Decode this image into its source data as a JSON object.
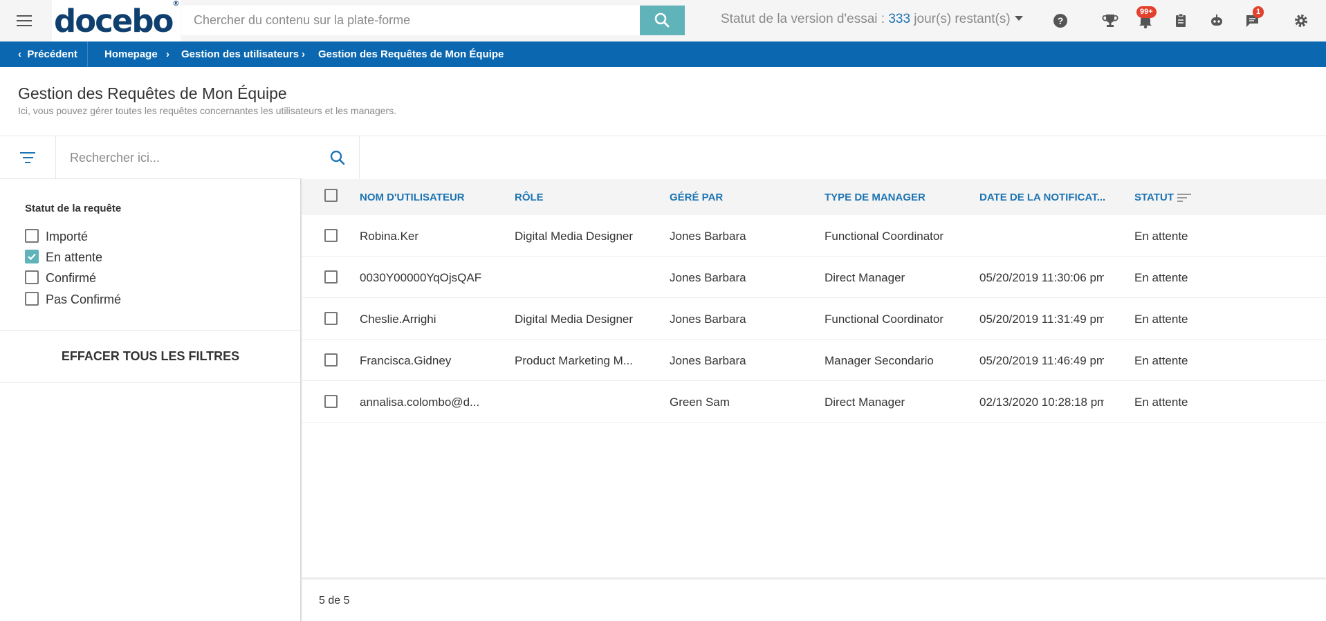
{
  "topbar": {
    "logo": "docebo",
    "logo_mark": "®",
    "search_placeholder": "Chercher du contenu sur la plate-forme",
    "trial_prefix": "Statut de la version d'essai : ",
    "trial_days": "333",
    "trial_suffix": " jour(s) restant(s)",
    "notifications_badge": "99+",
    "messages_badge": "1",
    "icons": [
      "menu-icon",
      "search-icon",
      "help-icon",
      "trophy-icon",
      "bell-icon",
      "clipboard-icon",
      "robot-icon",
      "chat-icon",
      "gear-icon"
    ]
  },
  "breadcrumb": {
    "back": "Précédent",
    "items": [
      "Homepage",
      "Gestion des utilisateurs",
      "Gestion des Requêtes de Mon Équipe"
    ]
  },
  "page": {
    "title": "Gestion des Requêtes de Mon Équipe",
    "subtitle": "Ici, vous pouvez gérer toutes les requêtes concernantes les utilisateurs et les managers."
  },
  "filters": {
    "search_placeholder": "Rechercher ici...",
    "group_title": "Statut de la requête",
    "options": [
      {
        "label": "Importé",
        "checked": false
      },
      {
        "label": "En attente",
        "checked": true
      },
      {
        "label": "Confirmé",
        "checked": false
      },
      {
        "label": "Pas Confirmé",
        "checked": false
      }
    ],
    "clear_label": "EFFACER TOUS LES FILTRES"
  },
  "table": {
    "columns": [
      "NOM D'UTILISATEUR",
      "RÔLE",
      "GÉRÉ PAR",
      "TYPE DE MANAGER",
      "DATE DE LA NOTIFICAT...",
      "STATUT"
    ],
    "rows": [
      [
        "Robina.Ker",
        "Digital Media Designer",
        "Jones Barbara",
        "Functional Coordinator",
        "",
        "En attente"
      ],
      [
        "0030Y00000YqOjsQAF",
        "",
        "Jones Barbara",
        "Direct Manager",
        "05/20/2019 11:30:06 pm",
        "En attente"
      ],
      [
        "Cheslie.Arrighi",
        "Digital Media Designer",
        "Jones Barbara",
        "Functional Coordinator",
        "05/20/2019 11:31:49 pm",
        "En attente"
      ],
      [
        "Francisca.Gidney",
        "Product Marketing M...",
        "Jones Barbara",
        "Manager Secondario",
        "05/20/2019 11:46:49 pm",
        "En attente"
      ],
      [
        "annalisa.colombo@d...",
        "",
        "Green Sam",
        "Direct Manager",
        "02/13/2020 10:28:18 pm",
        "En attente"
      ]
    ]
  },
  "pager": {
    "text": "5 de 5"
  },
  "colors": {
    "brand_blue": "#0b68b0",
    "accent_teal": "#5fb3b9",
    "badge_red": "#e2412d",
    "link_blue": "#1d74b3"
  }
}
